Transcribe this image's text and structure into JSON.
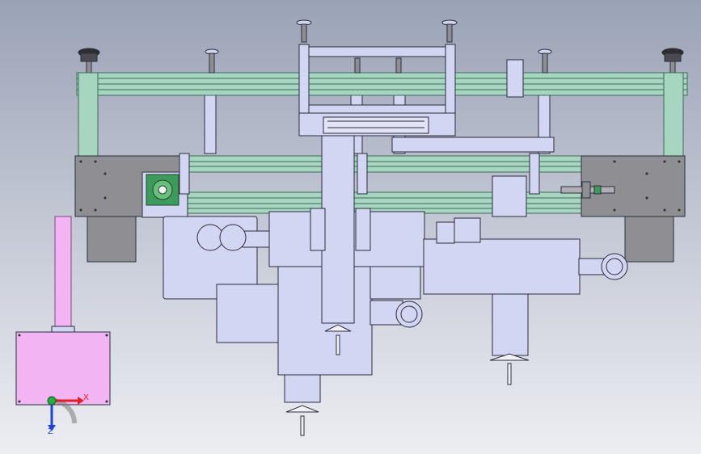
{
  "viewport": {
    "background_top": "#9aa2b6",
    "background_bottom": "#eceef2"
  },
  "colors": {
    "frame_green": "#a6d6c0",
    "frame_edge": "#3e6a58",
    "steel_gray": "#8f8f93",
    "part_lavender": "#d2d6f2",
    "part_edge": "#2a2d3c",
    "motor_pink": "#f2b4f2",
    "bearing_green": "#3c9a5a",
    "axis_x": "#e02020",
    "axis_y": "#20b040",
    "axis_z": "#2040e0"
  },
  "triad": {
    "x_label": "X",
    "z_label": "Z",
    "icon": "coordinate-triad-icon"
  }
}
